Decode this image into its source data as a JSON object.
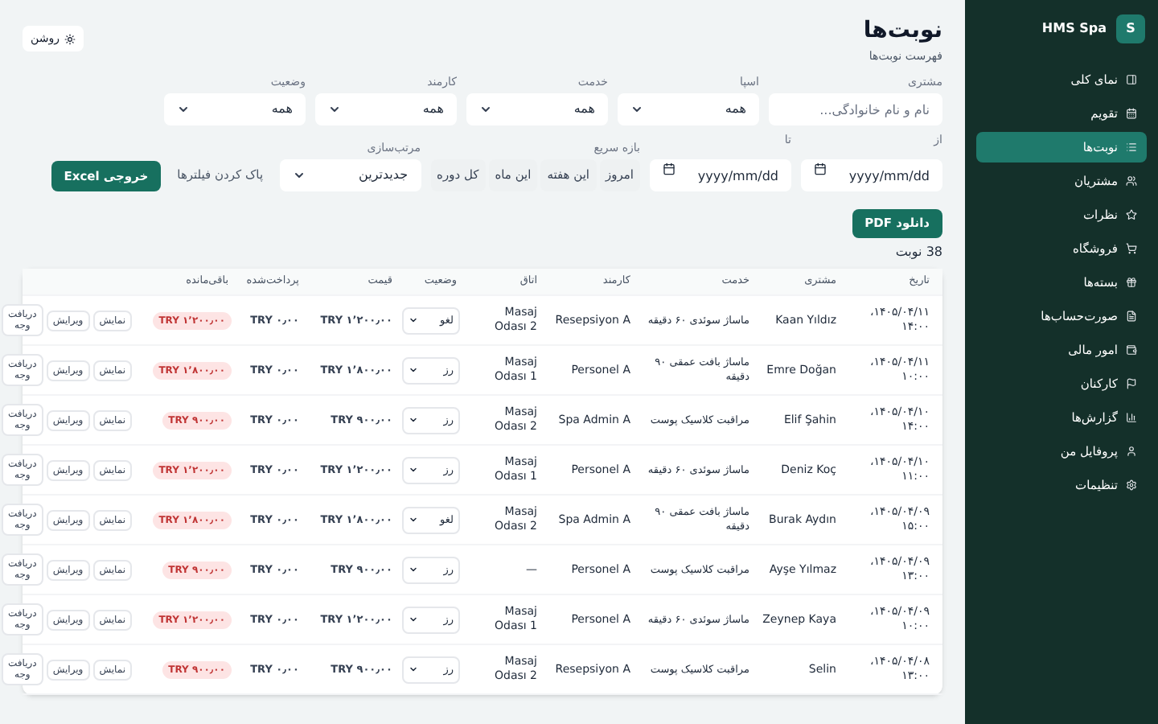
{
  "sidebar": {
    "logo": "S",
    "brand": "HMS Spa",
    "items": [
      {
        "label": "نمای کلی",
        "selected": false
      },
      {
        "label": "تقویم",
        "selected": false
      },
      {
        "label": "نوبت‌ها",
        "selected": true
      },
      {
        "label": "مشتریان",
        "selected": false
      },
      {
        "label": "نظرات",
        "selected": false
      },
      {
        "label": "فروشگاه",
        "selected": false
      },
      {
        "label": "بسته‌ها",
        "selected": false
      },
      {
        "label": "صورت‌حساب‌ها",
        "selected": false
      },
      {
        "label": "امور مالی",
        "selected": false
      },
      {
        "label": "کارکنان",
        "selected": false
      },
      {
        "label": "گزارش‌ها",
        "selected": false
      },
      {
        "label": "پروفایل من",
        "selected": false
      },
      {
        "label": "تنظیمات",
        "selected": false
      }
    ]
  },
  "header": {
    "title": "نوبت‌ها",
    "subtitle": "فهرست نوبت‌ها",
    "theme_button": "روشن"
  },
  "filters": {
    "fields": [
      {
        "kind": "input",
        "label": "مشتری",
        "placeholder": "نام و نام خانوادگی..."
      },
      {
        "kind": "select",
        "label": "اسپا",
        "value": "همه"
      },
      {
        "kind": "select",
        "label": "خدمت",
        "value": "همه"
      },
      {
        "kind": "select",
        "label": "کارمند",
        "value": "همه"
      },
      {
        "kind": "select",
        "label": "وضعیت",
        "value": "همه"
      }
    ],
    "from": {
      "label": "از",
      "placeholder": "yyyy/mm/dd"
    },
    "to": {
      "label": "تا",
      "placeholder": "yyyy/mm/dd"
    },
    "quick_range": {
      "label": "بازه سریع",
      "options": [
        "امروز",
        "این هفته",
        "این ماه",
        "کل دوره"
      ]
    },
    "sort": {
      "label": "مرتب‌سازی",
      "value": "جدیدترین"
    },
    "clear_link": "پاک کردن فیلترها",
    "excel_button": "خروجی Excel"
  },
  "pdf_button": "دانلود PDF",
  "count": "38 نوبت",
  "table": {
    "columns": [
      "تاریخ",
      "مشتری",
      "خدمت",
      "کارمند",
      "اتاق",
      "وضعیت",
      "قیمت",
      "پرداخت‌شده",
      "باقی‌مانده"
    ],
    "rows": [
      {
        "date": "۱۴۰۵/۰۴/۱۱، ۱۴:۰۰",
        "customer": "Kaan Yıldız",
        "service": "ماساژ سوئدی ۶۰ دقیقه",
        "staff": "Resepsiyon A",
        "room": "Masaj Odası 2",
        "status": "لغو",
        "price": "TRY ۱٬۲۰۰٫۰۰",
        "paid": "TRY ۰٫۰۰",
        "remaining": "TRY ۱٬۲۰۰٫۰۰",
        "actions": [
          "نمایش",
          "ویرایش",
          "دریافت وجه"
        ]
      },
      {
        "date": "۱۴۰۵/۰۴/۱۱، ۱۰:۰۰",
        "customer": "Emre Doğan",
        "service": "ماساژ بافت عمقی ۹۰ دقیقه",
        "staff": "Personel A",
        "room": "Masaj Odası 1",
        "status": "رز",
        "price": "TRY ۱٬۸۰۰٫۰۰",
        "paid": "TRY ۰٫۰۰",
        "remaining": "TRY ۱٬۸۰۰٫۰۰",
        "actions": [
          "نمایش",
          "ویرایش",
          "دریافت وجه"
        ]
      },
      {
        "date": "۱۴۰۵/۰۴/۱۰، ۱۴:۰۰",
        "customer": "Elif Şahin",
        "service": "مراقبت کلاسیک پوست",
        "staff": "Spa Admin A",
        "room": "Masaj Odası 2",
        "status": "رز",
        "price": "TRY ۹۰۰٫۰۰",
        "paid": "TRY ۰٫۰۰",
        "remaining": "TRY ۹۰۰٫۰۰",
        "actions": [
          "نمایش",
          "ویرایش",
          "دریافت وجه"
        ]
      },
      {
        "date": "۱۴۰۵/۰۴/۱۰، ۱۱:۰۰",
        "customer": "Deniz Koç",
        "service": "ماساژ سوئدی ۶۰ دقیقه",
        "staff": "Personel A",
        "room": "Masaj Odası 1",
        "status": "رز",
        "price": "TRY ۱٬۲۰۰٫۰۰",
        "paid": "TRY ۰٫۰۰",
        "remaining": "TRY ۱٬۲۰۰٫۰۰",
        "actions": [
          "نمایش",
          "ویرایش",
          "دریافت وجه"
        ]
      },
      {
        "date": "۱۴۰۵/۰۴/۰۹، ۱۵:۰۰",
        "customer": "Burak Aydın",
        "service": "ماساژ بافت عمقی ۹۰ دقیقه",
        "staff": "Spa Admin A",
        "room": "Masaj Odası 2",
        "status": "لغو",
        "price": "TRY ۱٬۸۰۰٫۰۰",
        "paid": "TRY ۰٫۰۰",
        "remaining": "TRY ۱٬۸۰۰٫۰۰",
        "actions": [
          "نمایش",
          "ویرایش",
          "دریافت وجه"
        ]
      },
      {
        "date": "۱۴۰۵/۰۴/۰۹، ۱۳:۰۰",
        "customer": "Ayşe Yılmaz",
        "service": "مراقبت کلاسیک پوست",
        "staff": "Personel A",
        "room": "—",
        "status": "رز",
        "price": "TRY ۹۰۰٫۰۰",
        "paid": "TRY ۰٫۰۰",
        "remaining": "TRY ۹۰۰٫۰۰",
        "actions": [
          "نمایش",
          "ویرایش",
          "دریافت وجه"
        ]
      },
      {
        "date": "۱۴۰۵/۰۴/۰۹، ۱۰:۰۰",
        "customer": "Zeynep Kaya",
        "service": "ماساژ سوئدی ۶۰ دقیقه",
        "staff": "Personel A",
        "room": "Masaj Odası 1",
        "status": "رز",
        "price": "TRY ۱٬۲۰۰٫۰۰",
        "paid": "TRY ۰٫۰۰",
        "remaining": "TRY ۱٬۲۰۰٫۰۰",
        "actions": [
          "نمایش",
          "ویرایش",
          "دریافت وجه"
        ]
      },
      {
        "date": "۱۴۰۵/۰۴/۰۸، ۱۳:۰۰",
        "customer": "Selin",
        "service": "مراقبت کلاسیک پوست",
        "staff": "Resepsiyon A",
        "room": "Masaj Odası 2",
        "status": "رز",
        "price": "TRY ۹۰۰٫۰۰",
        "paid": "TRY ۰٫۰۰",
        "remaining": "TRY ۹۰۰٫۰۰",
        "actions": [
          "نمایش",
          "ویرایش",
          "دریافت وجه"
        ]
      }
    ]
  }
}
